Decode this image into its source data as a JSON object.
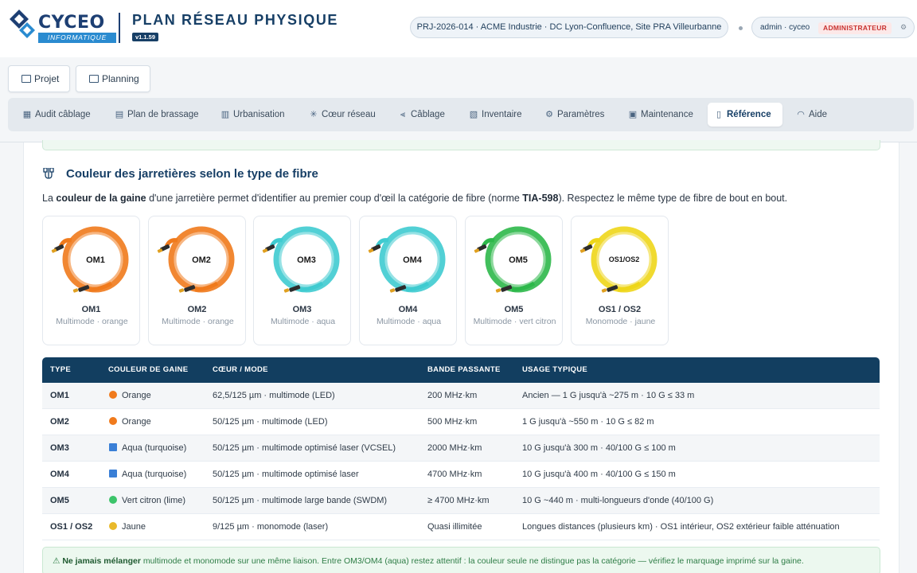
{
  "header": {
    "logo_name": "CYCEO",
    "logo_sub": "INFORMATIQUE",
    "app_title": "PLAN RÉSEAU PHYSIQUE",
    "version": "v1.1.59",
    "project": "PRJ-2026-014 · ACME Industrie · DC Lyon-Confluence, Site PRA Villeurbanne",
    "user": "admin · cyceo",
    "role": "ADMINISTRATEUR"
  },
  "top_tabs": [
    {
      "label": "Projet",
      "icon": "folder-icon"
    },
    {
      "label": "Planning",
      "icon": "calendar-icon"
    }
  ],
  "nav": [
    {
      "label": "Audit câblage",
      "icon": "audit-icon"
    },
    {
      "label": "Plan de brassage",
      "icon": "patch-plan-icon"
    },
    {
      "label": "Urbanisation",
      "icon": "rack-icon"
    },
    {
      "label": "Cœur réseau",
      "icon": "core-network-icon"
    },
    {
      "label": "Câblage",
      "icon": "cable-icon"
    },
    {
      "label": "Inventaire",
      "icon": "inventory-icon"
    },
    {
      "label": "Paramètres",
      "icon": "gear-icon"
    },
    {
      "label": "Maintenance",
      "icon": "save-icon"
    },
    {
      "label": "Référence",
      "icon": "book-icon",
      "active": true
    },
    {
      "label": "Aide",
      "icon": "headset-icon"
    }
  ],
  "section": {
    "title": "Couleur des jarretières selon le type de fibre",
    "intro_pre": "La ",
    "intro_bold1": "couleur de la gaine",
    "intro_mid": " d'une jarretière permet d'identifier au premier coup d'œil la catégorie de fibre (norme ",
    "intro_bold2": "TIA-598",
    "intro_post": "). Respectez le même type de fibre de bout en bout."
  },
  "fibers": [
    {
      "label": "OM1",
      "badge": "OM1",
      "desc": "Multimode · orange",
      "color": "#f07a1c"
    },
    {
      "label": "OM2",
      "badge": "OM2",
      "desc": "Multimode · orange",
      "color": "#f07a1c"
    },
    {
      "label": "OM3",
      "badge": "OM3",
      "desc": "Multimode · aqua",
      "color": "#3fcbd0"
    },
    {
      "label": "OM4",
      "badge": "OM4",
      "desc": "Multimode · aqua",
      "color": "#3fcbd0"
    },
    {
      "label": "OM5",
      "badge": "OM5",
      "desc": "Multimode · vert citron",
      "color": "#2db84a"
    },
    {
      "label": "OS1 / OS2",
      "badge": "OS1/OS2",
      "desc": "Monomode · jaune",
      "color": "#eed619"
    }
  ],
  "table": {
    "headers": [
      "TYPE",
      "COULEUR DE GAINE",
      "CŒUR / MODE",
      "BANDE PASSANTE",
      "USAGE TYPIQUE"
    ],
    "rows": [
      {
        "type": "OM1",
        "color_name": "Orange",
        "color": "#f07a1c",
        "swatch": "circle",
        "core": "62,5/125 µm · multimode (LED)",
        "bandwidth": "200 MHz·km",
        "usage": "Ancien — 1 G jusqu'à ~275 m · 10 G ≤ 33 m"
      },
      {
        "type": "OM2",
        "color_name": "Orange",
        "color": "#f07a1c",
        "swatch": "circle",
        "core": "50/125 µm · multimode (LED)",
        "bandwidth": "500 MHz·km",
        "usage": "1 G jusqu'à ~550 m · 10 G ≤ 82 m"
      },
      {
        "type": "OM3",
        "color_name": "Aqua (turquoise)",
        "color": "#3a7fd6",
        "swatch": "square",
        "core": "50/125 µm · multimode optimisé laser (VCSEL)",
        "bandwidth": "2000 MHz·km",
        "usage": "10 G jusqu'à 300 m · 40/100 G ≤ 100 m"
      },
      {
        "type": "OM4",
        "color_name": "Aqua (turquoise)",
        "color": "#3a7fd6",
        "swatch": "square",
        "core": "50/125 µm · multimode optimisé laser",
        "bandwidth": "4700 MHz·km",
        "usage": "10 G jusqu'à 400 m · 40/100 G ≤ 150 m"
      },
      {
        "type": "OM5",
        "color_name": "Vert citron (lime)",
        "color": "#3cc46a",
        "swatch": "circle",
        "core": "50/125 µm · multimode large bande (SWDM)",
        "bandwidth": "≥ 4700 MHz·km",
        "usage": "10 G ~440 m · multi-longueurs d'onde (40/100 G)"
      },
      {
        "type": "OS1 / OS2",
        "color_name": "Jaune",
        "color": "#e9b92a",
        "swatch": "circle",
        "core": "9/125 µm · monomode (laser)",
        "bandwidth": "Quasi illimitée",
        "usage": "Longues distances (plusieurs km) · OS1 intérieur, OS2 extérieur faible atténuation"
      }
    ]
  },
  "warning": {
    "icon": "⚠",
    "bold": "Ne jamais mélanger",
    "text": " multimode et monomode sur une même liaison. Entre OM3/OM4 (aqua) restez attentif : la couleur seule ne distingue pas la catégorie — vérifiez le marquage imprimé sur la gaine."
  }
}
